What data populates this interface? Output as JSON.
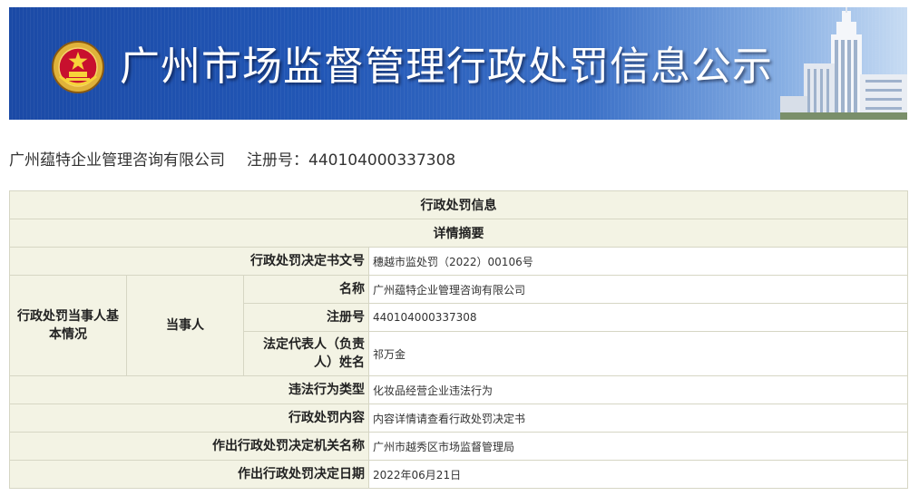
{
  "header": {
    "title": "广州市场监督管理行政处罚信息公示"
  },
  "company": {
    "name": "广州蕴特企业管理咨询有限公司",
    "reg_label": "注册号：",
    "reg_number": "440104000337308"
  },
  "table": {
    "section_title": "行政处罚信息",
    "summary_title": "详情摘要",
    "party_group_label": "行政处罚当事人基本情况",
    "party_sub_label": "当事人",
    "rows": {
      "decision_no": {
        "label": "行政处罚决定书文号",
        "value": "穗越市监处罚（2022）00106号"
      },
      "name": {
        "label": "名称",
        "value": "广州蕴特企业管理咨询有限公司"
      },
      "reg_no": {
        "label": "注册号",
        "value": "440104000337308"
      },
      "legal_rep": {
        "label": "法定代表人（负责人）姓名",
        "value": "祁万金"
      },
      "violation_type": {
        "label": "违法行为类型",
        "value": "化妆品经营企业违法行为"
      },
      "penalty_content": {
        "label": "行政处罚内容",
        "value": "内容详情请查看行政处罚决定书"
      },
      "authority": {
        "label": "作出行政处罚决定机关名称",
        "value": "广州市越秀区市场监督管理局"
      },
      "date": {
        "label": "作出行政处罚决定日期",
        "value": "2022年06月21日"
      }
    }
  },
  "colors": {
    "banner_blue": "#2257b6",
    "label_bg": "#f3f3e4",
    "border": "#d6d6c4"
  }
}
